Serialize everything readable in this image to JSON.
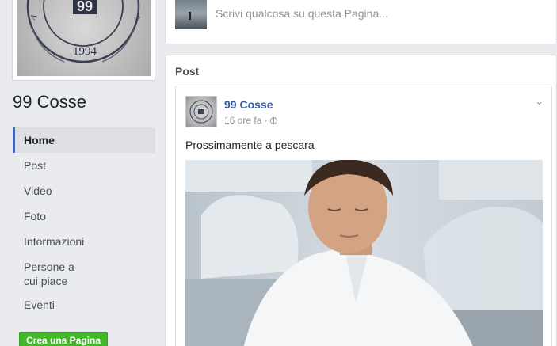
{
  "page": {
    "name": "99 Cosse",
    "cover_text_number": "99",
    "cover_text_year": "1994"
  },
  "nav": {
    "items": [
      {
        "label": "Home",
        "active": true
      },
      {
        "label": "Post"
      },
      {
        "label": "Video"
      },
      {
        "label": "Foto"
      },
      {
        "label": "Informazioni"
      },
      {
        "label": "Persone a\ncui piace"
      },
      {
        "label": "Eventi"
      }
    ],
    "create_page_label": "Crea una Pagina"
  },
  "composer": {
    "placeholder": "Scrivi qualcosa su questa Pagina..."
  },
  "posts_section": {
    "heading": "Post"
  },
  "post": {
    "author": "99 Cosse",
    "time": "16 ore fa ·",
    "text": "Prossimamente a pescara",
    "icons": {
      "privacy": "globe-icon",
      "menu": "chevron-down-icon",
      "mute": "mute-icon"
    }
  },
  "colors": {
    "background": "#e9ebee",
    "link": "#365899",
    "active_nav_border": "#4267b2",
    "create_button": "#42b72a"
  }
}
